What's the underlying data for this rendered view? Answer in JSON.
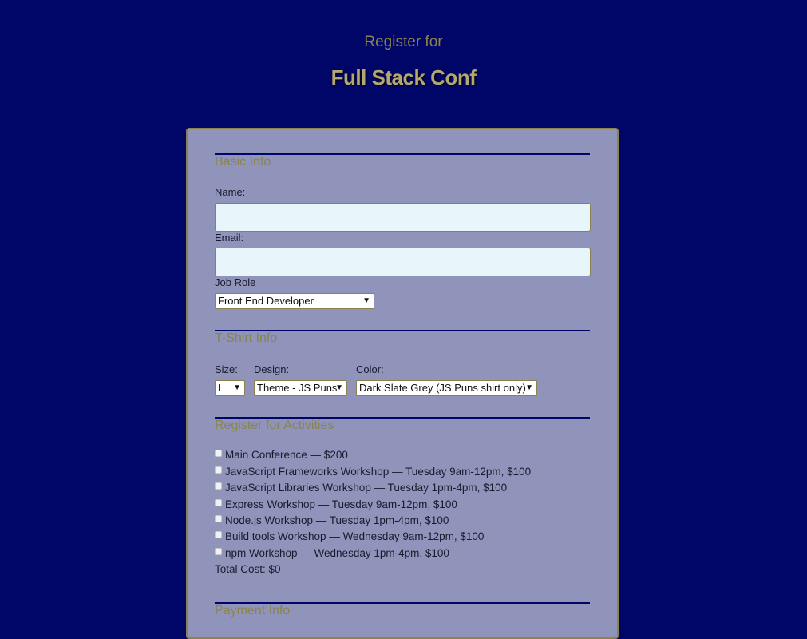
{
  "header": {
    "subtitle": "Register for",
    "title": "Full Stack Conf"
  },
  "basic_info": {
    "title": "Basic Info",
    "name_label": "Name:",
    "name_value": "",
    "email_label": "Email:",
    "email_value": "",
    "job_role_label": "Job Role",
    "job_role_selected": "Front End Developer"
  },
  "tshirt": {
    "title": "T-Shirt Info",
    "size_label": "Size:",
    "size_selected": "L",
    "design_label": "Design:",
    "design_selected": "Theme - JS Puns",
    "color_label": "Color:",
    "color_selected": "Dark Slate Grey (JS Puns shirt only)"
  },
  "activities": {
    "title": "Register for Activities",
    "items": [
      {
        "label": "Main Conference — $200",
        "checked": false
      },
      {
        "label": "JavaScript Frameworks Workshop — Tuesday 9am-12pm, $100",
        "checked": false
      },
      {
        "label": "JavaScript Libraries Workshop — Tuesday 1pm-4pm, $100",
        "checked": false
      },
      {
        "label": "Express Workshop — Tuesday 9am-12pm, $100",
        "checked": false
      },
      {
        "label": "Node.js Workshop — Tuesday 1pm-4pm, $100",
        "checked": false
      },
      {
        "label": "Build tools Workshop — Wednesday 9am-12pm, $100",
        "checked": false
      },
      {
        "label": "npm Workshop — Wednesday 1pm-4pm, $100",
        "checked": false
      }
    ],
    "total_label": "Total Cost: $0"
  },
  "payment": {
    "title": "Payment Info"
  },
  "colors": {
    "background": "#000568",
    "card": "#9094bb",
    "accent": "#8a8350",
    "input_bg": "#e8f5fa"
  }
}
